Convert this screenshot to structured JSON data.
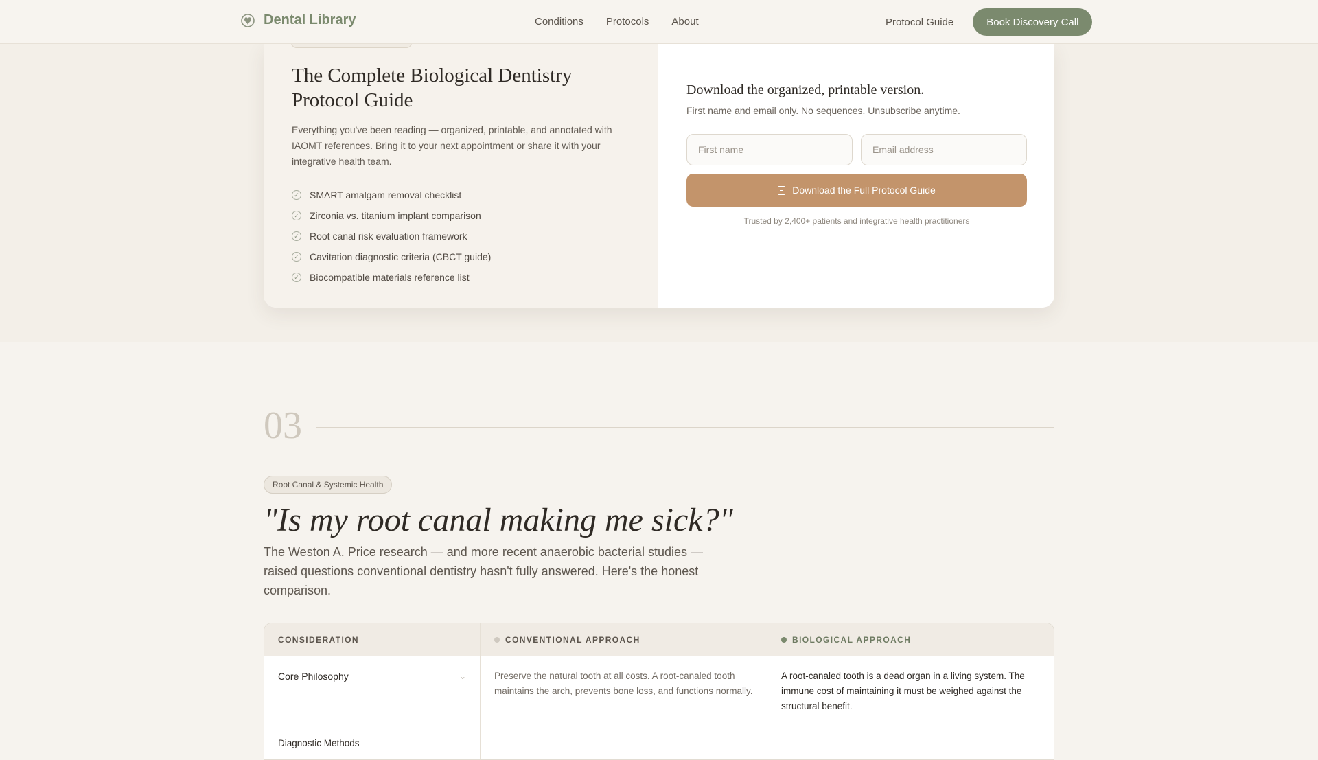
{
  "nav": {
    "brand": "Dental Library",
    "links": [
      "Conditions",
      "Protocols",
      "About"
    ],
    "guide": "Protocol Guide",
    "cta": "Book Discovery Call"
  },
  "guide": {
    "title": "The Complete Biological Dentistry Protocol Guide",
    "description": "Everything you've been reading — organized, printable, and annotated with IAOMT references. Bring it to your next appointment or share it with your integrative health team.",
    "checklist": [
      "SMART amalgam removal checklist",
      "Zirconia vs. titanium implant comparison",
      "Root canal risk evaluation framework",
      "Cavitation diagnostic criteria (CBCT guide)",
      "Biocompatible materials reference list"
    ],
    "form": {
      "title": "Download the organized, printable version.",
      "subtitle": "First name and email only. No sequences. Unsubscribe anytime.",
      "first_name_placeholder": "First name",
      "email_placeholder": "Email address",
      "button": "Download the Full Protocol Guide",
      "trusted": "Trusted by 2,400+ patients and integrative health practitioners"
    }
  },
  "section": {
    "number": "03",
    "tag": "Root Canal & Systemic Health",
    "headline": "\"Is my root canal making me sick?\"",
    "lede": "The Weston A. Price research — and more recent anaerobic bacterial studies — raised questions conventional dentistry hasn't fully answered. Here's the honest comparison."
  },
  "table": {
    "headers": {
      "consideration": "CONSIDERATION",
      "conventional": "CONVENTIONAL APPROACH",
      "biological": "BIOLOGICAL APPROACH"
    },
    "rows": [
      {
        "consideration": "Core Philosophy",
        "conventional": "Preserve the natural tooth at all costs. A root-canaled tooth maintains the arch, prevents bone loss, and functions normally.",
        "biological": "A root-canaled tooth is a dead organ in a living system. The immune cost of maintaining it must be weighed against the structural benefit."
      },
      {
        "consideration": "Diagnostic Methods"
      }
    ]
  },
  "colors": {
    "accent_green": "#7b8a6e",
    "accent_tan": "#c3946b",
    "background": "#f6f3ee"
  }
}
